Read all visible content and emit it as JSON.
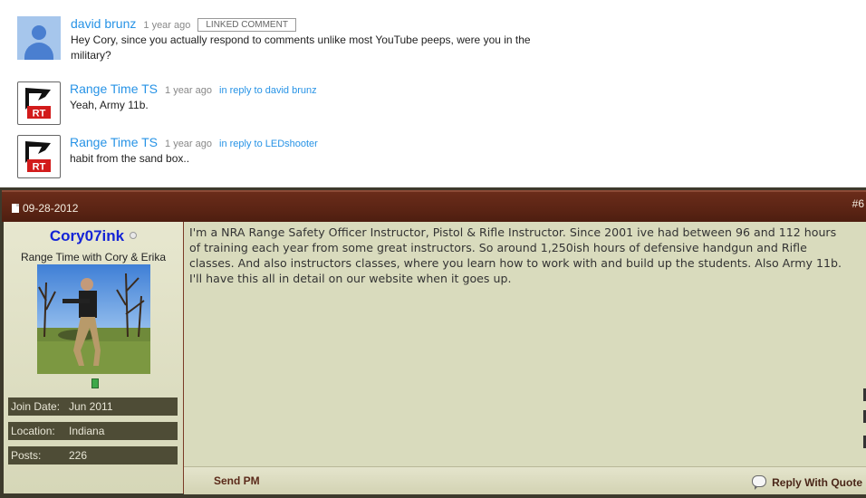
{
  "comments": [
    {
      "author": "david brunz",
      "age": "1 year ago",
      "badge": "LINKED COMMENT",
      "reply_to": "",
      "text": "Hey Cory, since you actually respond to comments unlike most YouTube peeps, were you in the military?",
      "avatar": "default-user-icon"
    },
    {
      "author": "Range Time TS",
      "age": "1 year ago",
      "badge": "",
      "reply_to": "in reply to david brunz",
      "text": "Yeah, Army 11b.",
      "avatar": "rt-logo"
    },
    {
      "author": "Range Time TS",
      "age": "1 year ago",
      "badge": "",
      "reply_to": "in reply to LEDshooter",
      "text": "habit from the sand box..",
      "avatar": "rt-logo"
    }
  ],
  "rt_logo_text": "RT",
  "post": {
    "date": "09-28-2012",
    "number": "#6",
    "username": "Cory07ink",
    "user_title": "Range Time with Cory & Erika",
    "stats": [
      {
        "label": "Join Date:",
        "value": "Jun 2011"
      },
      {
        "label": "Location:",
        "value": "Indiana"
      },
      {
        "label": "Posts:",
        "value": "226"
      }
    ],
    "body": "I'm a NRA Range Safety Officer Instructor, Pistol & Rifle Instructor. Since 2001 ive had between 96 and 112 hours of training each year from some great instructors. So around 1,250ish hours of defensive handgun and Rifle classes. And also instructors classes, where you learn how to work with and build up the students. Also Army 11b. I'll have this all in detail on our website when it goes up.",
    "send_pm": "Send PM",
    "reply_with_quote": "Reply With Quote"
  },
  "colors": {
    "link_blue": "#2793e6",
    "post_header": "#5b2414",
    "username_blue": "#1424d6",
    "post_bg": "#d9dbbd",
    "stat_bg": "#4e4c36"
  }
}
